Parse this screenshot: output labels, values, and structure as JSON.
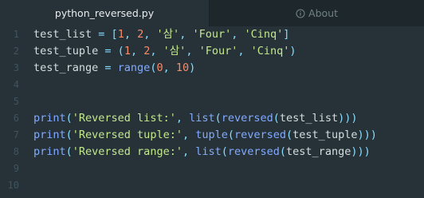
{
  "tabs": [
    {
      "label": "python_reversed.py",
      "active": true
    },
    {
      "label": "About",
      "icon": "info-icon",
      "active": false
    }
  ],
  "code": {
    "lines": [
      {
        "number": "1",
        "tokens": [
          {
            "t": "var",
            "v": "test_list"
          },
          {
            "t": "op",
            "v": " = "
          },
          {
            "t": "punc",
            "v": "["
          },
          {
            "t": "num",
            "v": "1"
          },
          {
            "t": "punc",
            "v": ", "
          },
          {
            "t": "num",
            "v": "2"
          },
          {
            "t": "punc",
            "v": ", "
          },
          {
            "t": "str",
            "v": "'삼'"
          },
          {
            "t": "punc",
            "v": ", "
          },
          {
            "t": "str",
            "v": "'Four'"
          },
          {
            "t": "punc",
            "v": ", "
          },
          {
            "t": "str",
            "v": "'Cinq'"
          },
          {
            "t": "punc",
            "v": "]"
          }
        ]
      },
      {
        "number": "2",
        "tokens": [
          {
            "t": "var",
            "v": "test_tuple"
          },
          {
            "t": "op",
            "v": " = "
          },
          {
            "t": "punc",
            "v": "("
          },
          {
            "t": "num",
            "v": "1"
          },
          {
            "t": "punc",
            "v": ", "
          },
          {
            "t": "num",
            "v": "2"
          },
          {
            "t": "punc",
            "v": ", "
          },
          {
            "t": "str",
            "v": "'삼'"
          },
          {
            "t": "punc",
            "v": ", "
          },
          {
            "t": "str",
            "v": "'Four'"
          },
          {
            "t": "punc",
            "v": ", "
          },
          {
            "t": "str",
            "v": "'Cinq'"
          },
          {
            "t": "punc",
            "v": ")"
          }
        ]
      },
      {
        "number": "3",
        "tokens": [
          {
            "t": "var",
            "v": "test_range"
          },
          {
            "t": "op",
            "v": " = "
          },
          {
            "t": "fn",
            "v": "range"
          },
          {
            "t": "punc",
            "v": "("
          },
          {
            "t": "num",
            "v": "0"
          },
          {
            "t": "punc",
            "v": ", "
          },
          {
            "t": "num",
            "v": "10"
          },
          {
            "t": "punc",
            "v": ")"
          }
        ]
      },
      {
        "number": "4",
        "tokens": []
      },
      {
        "number": "5",
        "tokens": []
      },
      {
        "number": "6",
        "tokens": [
          {
            "t": "fn",
            "v": "print"
          },
          {
            "t": "punc",
            "v": "("
          },
          {
            "t": "str",
            "v": "'Reversed list:'"
          },
          {
            "t": "punc",
            "v": ", "
          },
          {
            "t": "fn",
            "v": "list"
          },
          {
            "t": "punc",
            "v": "("
          },
          {
            "t": "fn",
            "v": "reversed"
          },
          {
            "t": "punc",
            "v": "("
          },
          {
            "t": "var",
            "v": "test_list"
          },
          {
            "t": "punc",
            "v": ")))"
          }
        ]
      },
      {
        "number": "7",
        "tokens": [
          {
            "t": "fn",
            "v": "print"
          },
          {
            "t": "punc",
            "v": "("
          },
          {
            "t": "str",
            "v": "'Reversed tuple:'"
          },
          {
            "t": "punc",
            "v": ", "
          },
          {
            "t": "fn",
            "v": "tuple"
          },
          {
            "t": "punc",
            "v": "("
          },
          {
            "t": "fn",
            "v": "reversed"
          },
          {
            "t": "punc",
            "v": "("
          },
          {
            "t": "var",
            "v": "test_tuple"
          },
          {
            "t": "punc",
            "v": ")))"
          }
        ]
      },
      {
        "number": "8",
        "tokens": [
          {
            "t": "fn",
            "v": "print"
          },
          {
            "t": "punc",
            "v": "("
          },
          {
            "t": "str",
            "v": "'Reversed range:'"
          },
          {
            "t": "punc",
            "v": ", "
          },
          {
            "t": "fn",
            "v": "list"
          },
          {
            "t": "punc",
            "v": "("
          },
          {
            "t": "fn",
            "v": "reversed"
          },
          {
            "t": "punc",
            "v": "("
          },
          {
            "t": "var",
            "v": "test_range"
          },
          {
            "t": "punc",
            "v": ")))"
          }
        ]
      },
      {
        "number": "9",
        "tokens": []
      },
      {
        "number": "10",
        "tokens": []
      }
    ]
  },
  "colors": {
    "editor_bg": "#263238",
    "tabbar_bg": "#1e272c",
    "line_number": "#3f545e",
    "string": "#c3e88d",
    "number": "#f78c6c",
    "function": "#82aaff",
    "operator": "#89ddff",
    "identifier": "#d5dde0"
  }
}
